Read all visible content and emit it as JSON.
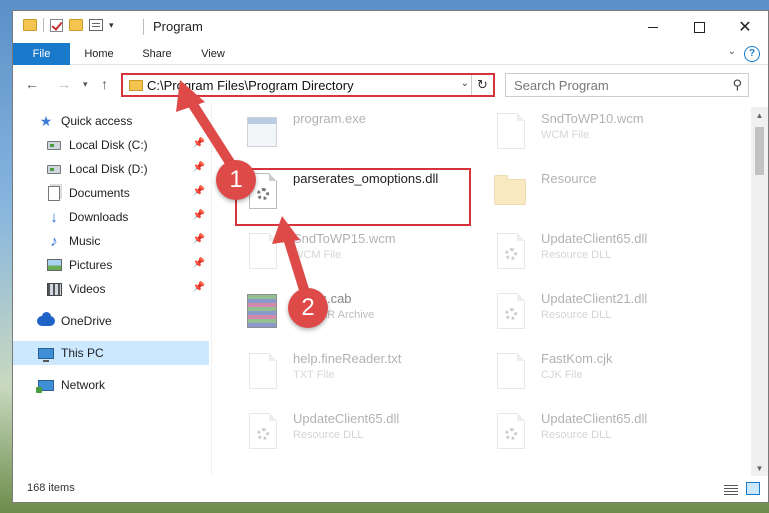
{
  "window": {
    "title": "Program",
    "controls": {
      "minimize": "",
      "maximize": "",
      "close": "✕"
    }
  },
  "ribbon": {
    "tabs": [
      "File",
      "Home",
      "Share",
      "View"
    ],
    "help": "?"
  },
  "nav": {
    "address": "C:\\Program Files\\Program Directory",
    "search_placeholder": "Search Program"
  },
  "sidebar": {
    "items": [
      {
        "label": "Quick access",
        "icon": "star-icon"
      },
      {
        "label": "Local Disk (C:)",
        "icon": "drive-icon",
        "pinned": true
      },
      {
        "label": "Local Disk (D:)",
        "icon": "drive-icon",
        "pinned": true
      },
      {
        "label": "Documents",
        "icon": "documents-icon",
        "pinned": true
      },
      {
        "label": "Downloads",
        "icon": "download-icon",
        "pinned": true
      },
      {
        "label": "Music",
        "icon": "music-icon",
        "pinned": true
      },
      {
        "label": "Pictures",
        "icon": "pictures-icon",
        "pinned": true
      },
      {
        "label": "Videos",
        "icon": "videos-icon",
        "pinned": true
      },
      {
        "label": "OneDrive",
        "icon": "onedrive-icon"
      },
      {
        "label": "This PC",
        "icon": "computer-icon",
        "selected": true
      },
      {
        "label": "Network",
        "icon": "network-icon"
      }
    ]
  },
  "files": [
    {
      "name": "program.exe",
      "type": "",
      "icon": "exe-icon"
    },
    {
      "name": "SndToWP10.wcm",
      "type": "WCM File",
      "icon": "document-icon"
    },
    {
      "name": "parserates_omoptions.dll",
      "type": "",
      "icon": "dll-icon",
      "highlight": true
    },
    {
      "name": "Resource",
      "type": "",
      "icon": "folder-icon"
    },
    {
      "name": "SndToWP15.wcm",
      "type": "WCM File",
      "icon": "document-icon"
    },
    {
      "name": "UpdateClient65.dll",
      "type": "Resource DLL",
      "icon": "dll-icon"
    },
    {
      "name": "Rates.cab",
      "type": "WinRAR Archive",
      "icon": "archive-icon"
    },
    {
      "name": "UpdateClient21.dll",
      "type": "Resource DLL",
      "icon": "dll-icon"
    },
    {
      "name": "help.fineReader.txt",
      "type": "TXT File",
      "icon": "document-icon"
    },
    {
      "name": "FastKom.cjk",
      "type": "CJK File",
      "icon": "document-icon"
    },
    {
      "name": "UpdateClient65.dll",
      "type": "Resource DLL",
      "icon": "dll-icon"
    },
    {
      "name": "UpdateClient65.dll",
      "type": "Resource DLL",
      "icon": "dll-icon"
    }
  ],
  "status": {
    "count": "168 items"
  },
  "callouts": {
    "one": "1",
    "two": "2"
  },
  "colors": {
    "accent": "#1979ca",
    "highlight": "#d5353a",
    "badge": "#dd4a48"
  }
}
